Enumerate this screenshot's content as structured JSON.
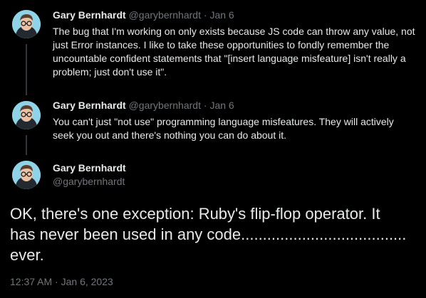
{
  "thread": [
    {
      "author": "Gary Bernhardt",
      "handle": "@garybernhardt",
      "separator": "·",
      "date": "Jan 6",
      "text": "The bug that I'm working on only exists because JS code can throw any value, not just Error instances. I like to take these opportunities to fondly remember the uncountable confident statements that \"[insert language misfeature] isn't really a problem; just don't use it\"."
    },
    {
      "author": "Gary Bernhardt",
      "handle": "@garybernhardt",
      "separator": "·",
      "date": "Jan 6",
      "text": "You can't just \"not use\" programming language misfeatures. They will actively seek you out and there's nothing you can do about it."
    }
  ],
  "main_tweet": {
    "author": "Gary Bernhardt",
    "handle": "@garybernhardt",
    "text": "OK, there's one exception: Ruby's flip-flop operator. It has never been used in any code...................................... ever.",
    "time": "12:37 AM",
    "separator": "·",
    "date": "Jan 6, 2023"
  },
  "colors": {
    "background": "#000000",
    "text_primary": "#e7e9ea",
    "text_secondary": "#71767b",
    "thread_line": "#333639",
    "avatar_background": "#8fd3e8"
  },
  "icons": {
    "avatar": "avatar-icon"
  }
}
